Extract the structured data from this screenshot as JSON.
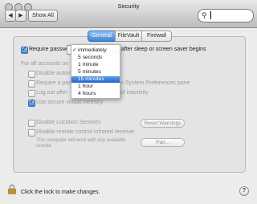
{
  "window": {
    "title": "Security"
  },
  "toolbar": {
    "show_all_label": "Show All",
    "search": {
      "value": "",
      "placeholder": ""
    }
  },
  "tabs": [
    {
      "label": "General",
      "active": true
    },
    {
      "label": "FileVault",
      "active": false
    },
    {
      "label": "Firewall",
      "active": false
    }
  ],
  "general": {
    "require_password": {
      "label": "Require password",
      "checked": true,
      "selected_value": "immediately",
      "suffix": "after sleep or screen saver begins"
    },
    "for_all_accounts_label": "For all accounts on",
    "options": [
      {
        "label": "Disable autom",
        "checked": false,
        "enabled": false
      },
      {
        "label": "Require a pass",
        "checked": false,
        "enabled": false,
        "suffix": "n System Preferences pane"
      },
      {
        "label": "Log out after",
        "checked": false,
        "enabled": false,
        "suffix": "of inactivity"
      },
      {
        "label": "Use secure virtual memory",
        "checked": true,
        "enabled": false
      }
    ],
    "location_services": {
      "label": "Disable Location Services",
      "checked": false,
      "enabled": false
    },
    "reset_warnings_label": "Reset Warnings",
    "remote_control": {
      "label": "Disable remote control infrared receiver",
      "checked": false,
      "enabled": false
    },
    "remote_note": "This computer will work with any available remote.",
    "pair_label": "Pair..."
  },
  "dropdown": {
    "items": [
      {
        "label": "immediately",
        "checked": true,
        "highlighted": false
      },
      {
        "label": "5 seconds",
        "checked": false,
        "highlighted": false
      },
      {
        "label": "1 minute",
        "checked": false,
        "highlighted": false
      },
      {
        "label": "5 minutes",
        "checked": false,
        "highlighted": false
      },
      {
        "label": "15 minutes",
        "checked": false,
        "highlighted": true
      },
      {
        "label": "1 hour",
        "checked": false,
        "highlighted": false
      },
      {
        "label": "4 hours",
        "checked": false,
        "highlighted": false
      }
    ]
  },
  "footer": {
    "lock_text": "Click the lock to make changes.",
    "help_label": "?"
  },
  "colors": {
    "accent": "#3c86d8",
    "highlight": "#2466cc",
    "window_bg": "#ececec"
  }
}
